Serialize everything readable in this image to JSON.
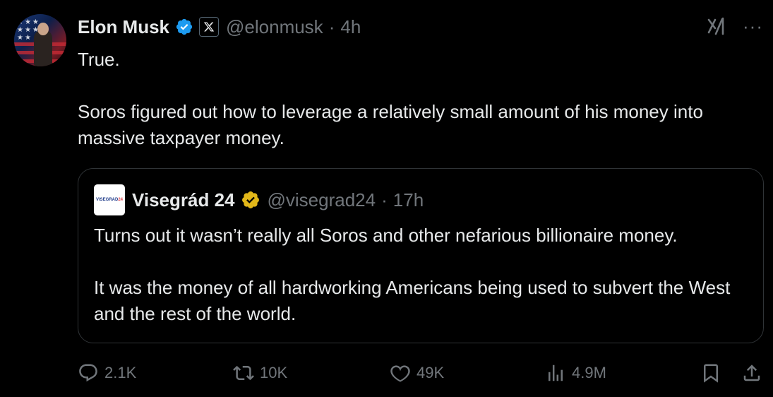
{
  "author": {
    "name": "Elon Musk",
    "handle": "@elonmusk",
    "separator": "·",
    "time": "4h",
    "verified_color": "#1d9bf0"
  },
  "tweet": {
    "text": "True.\n\nSoros figured out how to leverage a relatively small amount of his money into massive taxpayer money."
  },
  "quote": {
    "name": "Visegrád 24",
    "handle": "@visegrad24",
    "separator": "·",
    "time": "17h",
    "avatar_text_main": "VISEGRAD",
    "avatar_text_accent": "24",
    "badge_color": "#e2b719",
    "text": "Turns out it wasn’t really all Soros and other nefarious billionaire money.\n\nIt was the money of all hardworking Americans being used to subvert the West and the rest of the world."
  },
  "actions": {
    "replies": "2.1K",
    "reposts": "10K",
    "likes": "49K",
    "views": "4.9M"
  },
  "colors": {
    "background": "#000000",
    "text": "#e7e9ea",
    "muted": "#71767b",
    "border": "#2f3336"
  }
}
